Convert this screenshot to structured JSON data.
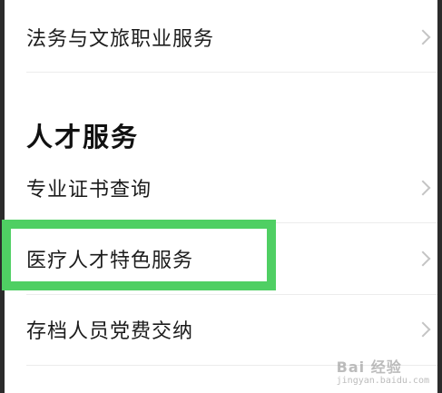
{
  "list_top": {
    "item": "法务与文旅职业服务"
  },
  "section": {
    "title": "人才服务",
    "items": [
      "专业证书查询",
      "医疗人才特色服务",
      "存档人员党费交纳"
    ]
  },
  "colors": {
    "highlight": "#4fcf63",
    "text": "#1c1c1c",
    "divider": "#ececec",
    "chevron": "#c4c4c4"
  },
  "icons": {
    "chevron": "chevron-right-icon"
  },
  "watermark": {
    "main": "Bai 经验",
    "sub": "jingyan.baidu.com"
  }
}
